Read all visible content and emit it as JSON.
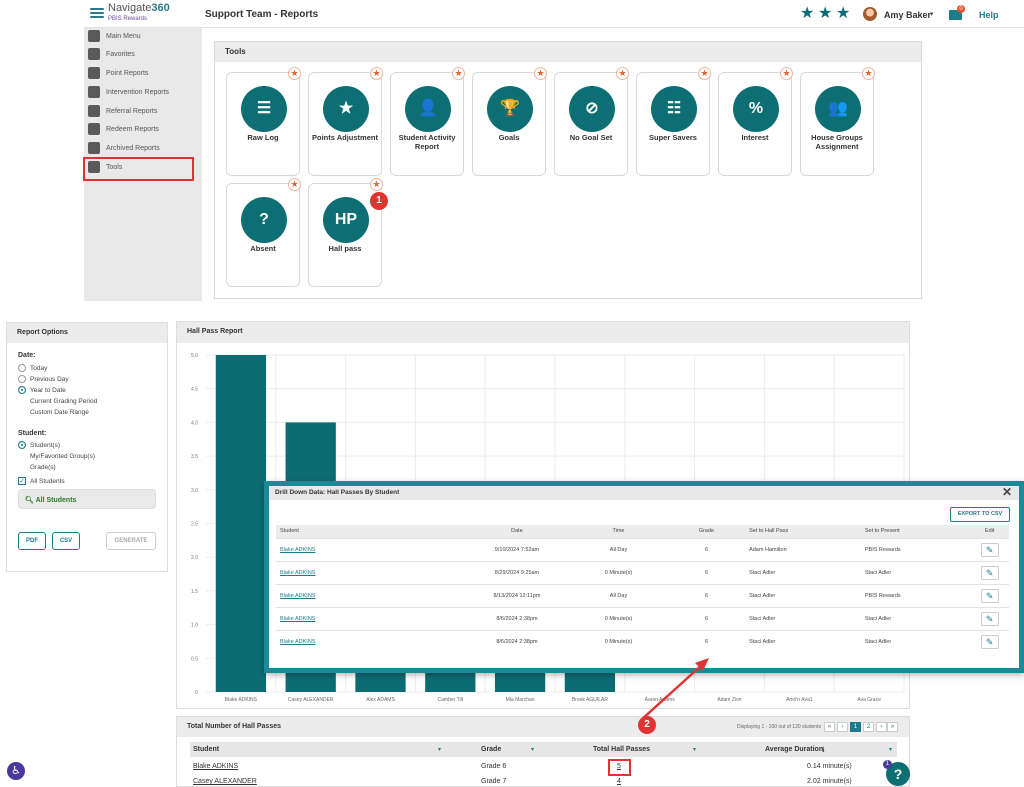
{
  "app": {
    "brand_name": "Navigate",
    "brand_number": "360",
    "brand_sub": "PBIS Rewards",
    "page_title": "Support Team - Reports",
    "user_name": "Amy Baker",
    "mail_count": "0",
    "help_label": "Help"
  },
  "sidebar": {
    "items": [
      {
        "label": "Main Menu",
        "icon": "back-arrow-icon"
      },
      {
        "label": "Favorites",
        "icon": "star-icon"
      },
      {
        "label": "Point Reports",
        "icon": "star-icon"
      },
      {
        "label": "Intervention Reports",
        "icon": "chat-icon"
      },
      {
        "label": "Referral Reports",
        "icon": "alert-icon"
      },
      {
        "label": "Redeem Reports",
        "icon": "cart-icon"
      },
      {
        "label": "Archived Reports",
        "icon": "history-icon"
      },
      {
        "label": "Tools",
        "icon": "gear-icon"
      }
    ]
  },
  "tools": {
    "title": "Tools",
    "tiles": [
      {
        "label": "Raw Log",
        "glyph": "☰"
      },
      {
        "label": "Points Adjustment",
        "glyph": "★"
      },
      {
        "label": "Student Activity Report",
        "glyph": "👤"
      },
      {
        "label": "Goals",
        "glyph": "🏆"
      },
      {
        "label": "No Goal Set",
        "glyph": "⊘"
      },
      {
        "label": "Super Savers",
        "glyph": "☷"
      },
      {
        "label": "Interest",
        "glyph": "%"
      },
      {
        "label": "House Groups Assignment",
        "glyph": "👥"
      },
      {
        "label": "Absent",
        "glyph": "?"
      },
      {
        "label": "Hall pass",
        "glyph": "HP"
      }
    ],
    "step_marker": "1"
  },
  "report_options": {
    "title": "Report Options",
    "date_label": "Date:",
    "date_options": [
      "Today",
      "Previous Day",
      "Year to Date",
      "Current Grading Period",
      "Custom Date Range"
    ],
    "date_selected": "Year to Date",
    "student_label": "Student:",
    "student_options": [
      "Student(s)",
      "My/Favorited Group(s)",
      "Grade(s)"
    ],
    "all_students_check": "All Students",
    "all_students_box": "All Students",
    "buttons": {
      "pdf": "PDF",
      "csv": "CSV",
      "generate": "GENERATE"
    }
  },
  "chart_data": {
    "type": "bar",
    "title": "Hall Pass Report",
    "categories": [
      "Blake ADKINS",
      "Casey ALEXANDER",
      "Alex ADAMS",
      "Camber Tilt",
      "Mia Marchan",
      "Brook AGUILAR",
      "Aaron Adams",
      "Adam Zion",
      "Amri'n Ava1",
      "Ava Grace"
    ],
    "values": [
      5,
      4,
      3,
      3,
      3,
      3,
      0,
      0,
      0,
      0
    ],
    "ylim": [
      0,
      5
    ],
    "yticks": [
      "0",
      "0.5",
      "1.0",
      "1.5",
      "2.0",
      "2.5",
      "3.0",
      "3.5",
      "4.0",
      "4.5",
      "5.0"
    ],
    "bar_color": "#0d6b73",
    "grid": true
  },
  "drilldown": {
    "title": "Drill Down Data: Hall Passes By Student",
    "export_label": "EXPORT TO CSV",
    "columns": [
      "Student",
      "Date",
      "Time",
      "Grade",
      "Set to Hall Pass",
      "Set to Present",
      "Edit"
    ],
    "rows": [
      {
        "student": "Blake ADKINS",
        "date": "9/10/2024 7:52am",
        "time": "All Day",
        "grade": "6",
        "hall": "Adam Hamilton",
        "present": "PBIS Rewards"
      },
      {
        "student": "Blake ADKINS",
        "date": "8/29/2024 9:25am",
        "time": "0 Minute(s)",
        "grade": "6",
        "hall": "Staci Adler",
        "present": "Staci Adler"
      },
      {
        "student": "Blake ADKINS",
        "date": "8/13/2024 12:11pm",
        "time": "All Day",
        "grade": "6",
        "hall": "Staci Adler",
        "present": "PBIS Rewards"
      },
      {
        "student": "Blake ADKINS",
        "date": "8/6/2024 2:38pm",
        "time": "0 Minute(s)",
        "grade": "6",
        "hall": "Staci Adler",
        "present": "Staci Adler"
      },
      {
        "student": "Blake ADKINS",
        "date": "8/6/2024 2:38pm",
        "time": "0 Minute(s)",
        "grade": "6",
        "hall": "Staci Adler",
        "present": "Staci Adler"
      }
    ]
  },
  "totals": {
    "title": "Total Number of Hall Passes",
    "pager_text": "Displaying 1 - 100 out of 120 students",
    "pages": [
      "1",
      "2"
    ],
    "columns": {
      "student": "Student",
      "grade": "Grade",
      "total": "Total Hall Passes",
      "avg": "Average Duration"
    },
    "rows": [
      {
        "student": "Blake ADKINS",
        "grade": "Grade 6",
        "total": "5",
        "avg": "0.14 minute(s)"
      },
      {
        "student": "Casey ALEXANDER",
        "grade": "Grade 7",
        "total": "4",
        "avg": "2.02 minute(s)"
      }
    ],
    "step_marker": "2"
  },
  "help_bubble": {
    "glyph": "?",
    "badge": "1"
  }
}
